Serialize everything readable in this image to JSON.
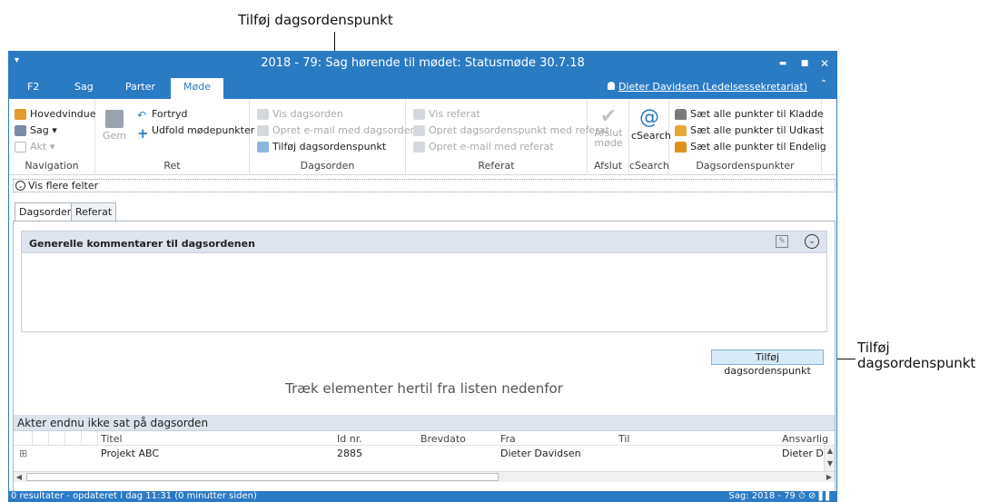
{
  "callouts": {
    "top": "Tilføj dagsordenspunkt",
    "right_line1": "Tilføj",
    "right_line2": "dagsordenspunkt"
  },
  "window": {
    "title": "2018 - 79: Sag hørende til mødet: Statusmøde 30.7.18",
    "system_menu_glyph": "▾",
    "minimize_glyph": "▬",
    "maximize_glyph": "■",
    "close_glyph": "✕"
  },
  "tabs": [
    {
      "label": "F2"
    },
    {
      "label": "Sag"
    },
    {
      "label": "Parter"
    },
    {
      "label": "Møde",
      "active": true
    }
  ],
  "user": {
    "name": "Dieter Davidsen (Ledelsessekretariat)",
    "collapse_glyph": "⌃"
  },
  "ribbon": {
    "navigation": {
      "label": "Navigation",
      "items": [
        "Hovedvindue",
        "Sag ▾",
        "Akt ▾"
      ]
    },
    "ret": {
      "label": "Ret",
      "save": "Gem",
      "undo": "Fortryd",
      "expand": "Udfold mødepunkter"
    },
    "dagsorden": {
      "label": "Dagsorden",
      "items": [
        "Vis dagsorden",
        "Opret e-mail med dagsorden",
        "Tilføj dagsordenspunkt"
      ]
    },
    "referat": {
      "label": "Referat",
      "items": [
        "Vis referat",
        "Opret dagsordenspunkt med referat",
        "Opret e-mail med referat"
      ]
    },
    "afslut": {
      "label": "Afslut",
      "button_line1": "Afslut",
      "button_line2": "møde"
    },
    "csearch": {
      "label": "cSearch",
      "button": "cSearch"
    },
    "dagsordenspunkter": {
      "label": "Dagsordenspunkter",
      "items": [
        "Sæt alle punkter til Kladde",
        "Sæt alle punkter til Udkast",
        "Sæt alle punkter til Endelig"
      ]
    }
  },
  "more_fields": "Vis flere felter",
  "content_tabs": [
    "Dagsorden",
    "Referat"
  ],
  "comments": {
    "title": "Generelle kommentarer til dagsordenen",
    "edit_glyph": "✎",
    "expand_glyph": "⌄"
  },
  "add_button": "Tilføj dagsordenspunkt",
  "drop_hint": "Træk elementer hertil fra listen nedenfor",
  "grid": {
    "title": "Akter endnu ikke sat på dagsorden",
    "columns": [
      "Titel",
      "Id nr.",
      "Brevdato",
      "Fra",
      "Til",
      "Ansvarlig"
    ],
    "rows": [
      {
        "expand": "⊞",
        "title": "Projekt ABC",
        "id": "2885",
        "letter_date": "",
        "from": "Dieter Davidsen",
        "to": "",
        "responsible": "Dieter Da"
      }
    ]
  },
  "status": {
    "left": "0 resultater - opdateret i dag 11:31 (0 minutter siden)",
    "right": "Sag: 2018 - 79 ⏱ ⊘ ▌▌"
  },
  "colors": {
    "accent": "#2b7bc4",
    "header_bg": "#dde4ee",
    "button_bg": "#d9e9f8"
  }
}
